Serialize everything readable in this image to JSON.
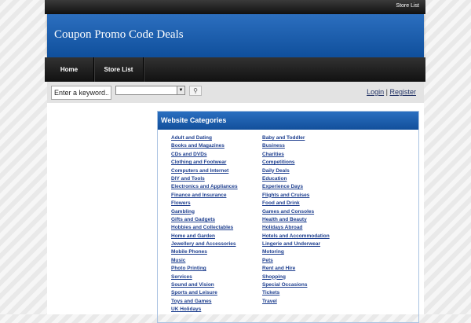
{
  "topbar": {
    "store_list_link": "Store List"
  },
  "header": {
    "site_title": "Coupon Promo Code Deals"
  },
  "nav": {
    "items": [
      "Home",
      "Store List"
    ]
  },
  "search": {
    "placeholder": "Enter a keyword...",
    "select_value": "",
    "button_icon": "magnifier-icon"
  },
  "auth": {
    "login": "Login",
    "separator": "|",
    "register": "Register"
  },
  "categories": {
    "heading": "Website Categories",
    "left": [
      "Adult and Dating",
      "Books and Magazines",
      "CDs and DVDs",
      "Clothing and Footwear",
      "Computers and Internet",
      "DIY and Tools",
      "Electronics and Appliances",
      "Finance and Insurance",
      "Flowers",
      "Gambling",
      "Gifts and Gadgets",
      "Hobbies and Collectables",
      "Home and Garden",
      "Jewellery and Accessories",
      "Mobile Phones",
      "Music",
      "Photo Printing",
      "Services",
      "Sound and Vision",
      "Sports and Leisure",
      "Toys and Games",
      "UK Holidays"
    ],
    "right": [
      "Baby and Toddler",
      "Business",
      "Charities",
      "Competitions",
      "Daily Deals",
      "Education",
      "Experience Days",
      "Flights and Cruises",
      "Food and Drink",
      "Games and Consoles",
      "Health and Beauty",
      "Holidays Abroad",
      "Hotels and Accommodation",
      "Lingerie and Underwear",
      "Motoring",
      "Pets",
      "Rent and Hire",
      "Shopping",
      "Special Occasions",
      "Tickets",
      "Travel"
    ]
  },
  "colors": {
    "header_blue": "#1a5fae",
    "link": "#1e3f8f",
    "nav_bg": "#1a1a1a"
  }
}
